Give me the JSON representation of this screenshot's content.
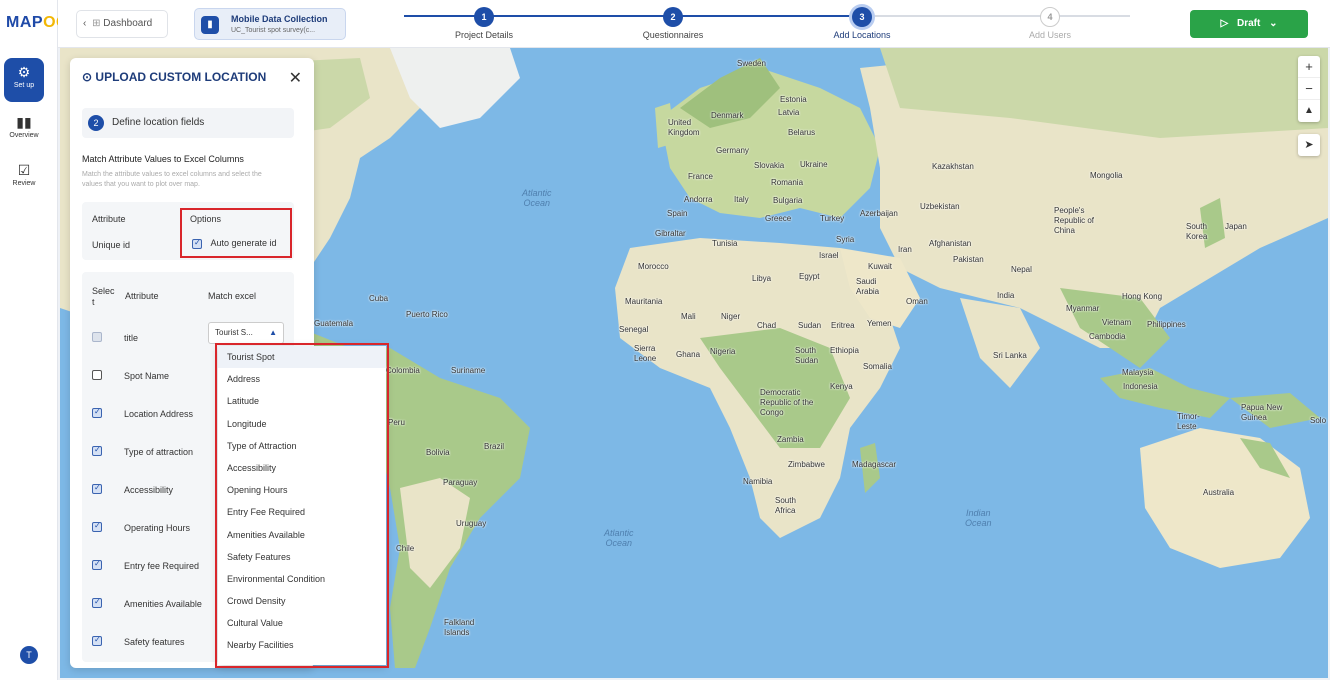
{
  "brand": {
    "logo_main": "MAP",
    "logo_accent": "OG"
  },
  "rail": {
    "items": [
      {
        "label": "Set up",
        "icon": "gear-icon"
      },
      {
        "label": "Overview",
        "icon": "bar-chart-icon"
      },
      {
        "label": "Review",
        "icon": "checkbox-icon"
      }
    ],
    "avatar_letter": "T"
  },
  "topbar": {
    "back_label": "Dashboard",
    "project": {
      "title": "Mobile Data Collection",
      "subtitle": "UC_Tourist spot survey(c..."
    },
    "steps": [
      {
        "num": "1",
        "label": "Project Details"
      },
      {
        "num": "2",
        "label": "Questionnaires"
      },
      {
        "num": "3",
        "label": "Add Locations"
      },
      {
        "num": "4",
        "label": "Add Users"
      }
    ],
    "draft_label": "Draft"
  },
  "panel": {
    "title": "UPLOAD CUSTOM LOCATION",
    "section_num": "2",
    "section_label": "Define location fields",
    "match_title": "Match Attribute Values to Excel Columns",
    "match_desc": "Match the attribute values to excel columns and select the values that you want to plot over map.",
    "table1": {
      "col_attribute": "Attribute",
      "col_options": "Options",
      "attr": "Unique id",
      "option": "Auto generate id"
    },
    "table2": {
      "col_select": "Selec t",
      "col_attribute": "Attribute",
      "col_match": "Match excel",
      "rows": [
        "title",
        "Spot Name",
        "Location Address",
        "Type of attraction",
        "Accessibility",
        "Operating Hours",
        "Entry fee Required",
        "Amenities Available",
        "Safety features"
      ],
      "selected_value": "Tourist S..."
    }
  },
  "dropdown": {
    "options": [
      "Tourist Spot",
      "Address",
      "Latitude",
      "Longitude",
      "Type of Attraction",
      "Accessibility",
      "Opening Hours",
      "Entry Fee Required",
      "Amenities Available",
      "Safety Features",
      "Environmental Condition",
      "Crowd Density",
      "Cultural Value",
      "Nearby Facilities"
    ]
  },
  "map": {
    "oceans": [
      "Atlantic\nOcean",
      "Atlantic\nOcean",
      "Indian\nOcean"
    ],
    "labels": [
      "Sweden",
      "Estonia",
      "Latvia",
      "Denmark",
      "United Kingdom",
      "Belarus",
      "Germany",
      "Slovakia",
      "Ukraine",
      "France",
      "Romania",
      "Andorra",
      "Italy",
      "Bulgaria",
      "Spain",
      "Greece",
      "Turkey",
      "Azerbaijan",
      "Gibraltar",
      "Tunisia",
      "Syria",
      "Iran",
      "Afghanistan",
      "Kazakhstan",
      "Uzbekistan",
      "Mongolia",
      "People's Republic of China",
      "South Korea",
      "Japan",
      "Israel",
      "Kuwait",
      "Pakistan",
      "Nepal",
      "Morocco",
      "Libya",
      "Egypt",
      "Saudi Arabia",
      "Oman",
      "India",
      "Hong Kong",
      "Myanmar",
      "Mauritania",
      "Mali",
      "Niger",
      "Chad",
      "Sudan",
      "Eritrea",
      "Yemen",
      "Vietnam",
      "Philippines",
      "Cambodia",
      "Senegal",
      "Sierra Leone",
      "Ghana",
      "Nigeria",
      "South Sudan",
      "Ethiopia",
      "Somalia",
      "Sri Lanka",
      "Malaysia",
      "Indonesia",
      "Democratic Republic of the Congo",
      "Kenya",
      "Papua New Guinea",
      "Timor-Leste",
      "Solo",
      "Zambia",
      "Zimbabwe",
      "Madagascar",
      "Namibia",
      "South Africa",
      "Australia",
      "Cuba",
      "Puerto Rico",
      "Guatemala",
      "Colombia",
      "Suriname",
      "Peru",
      "Bolivia",
      "Brazil",
      "Paraguay",
      "Uruguay",
      "Chile",
      "Falkland Islands"
    ]
  }
}
